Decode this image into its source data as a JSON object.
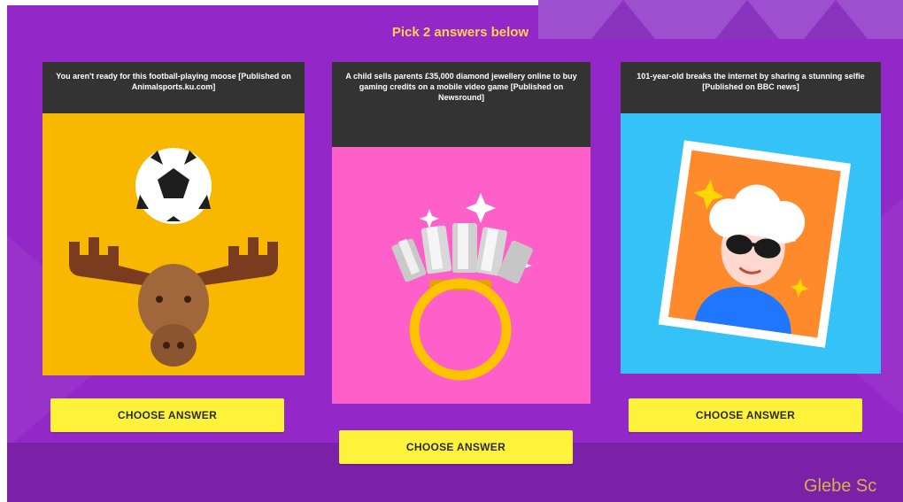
{
  "header": {
    "instruction": "Pick 2 answers below"
  },
  "cards": [
    {
      "caption": "You aren't ready for this football-playing moose [Published on Animalsports.ku.com]",
      "button_label": "CHOOSE ANSWER",
      "illustration": "moose-with-football-icon",
      "bg_color": "#f8b800"
    },
    {
      "caption": "A child sells parents £35,000 diamond jewellery online to buy gaming credits on a mobile video game [Published on Newsround]",
      "button_label": "CHOOSE ANSWER",
      "illustration": "diamond-ring-icon",
      "bg_color": "#ff5fc8"
    },
    {
      "caption": "101-year-old breaks the internet by sharing a stunning selfie [Published on BBC news]",
      "button_label": "CHOOSE ANSWER",
      "illustration": "selfie-photo-icon",
      "bg_color": "#35c2f7"
    }
  ],
  "footer": {
    "watermark": "Glebe Sc"
  },
  "colors": {
    "background": "#9427c8",
    "button": "#fff23a",
    "title": "#ffd34a",
    "caption_bg": "#333333"
  }
}
